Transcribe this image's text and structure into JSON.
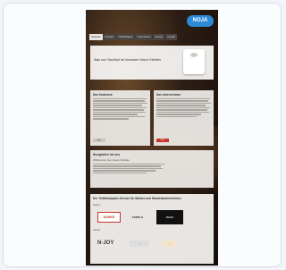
{
  "brand": {
    "logo_text": "NOJA"
  },
  "nav": {
    "items": [
      "Startseite",
      "Produkte",
      "Nachhaltigkeit",
      "Unternehmen",
      "Karriere",
      "Kontakt"
    ]
  },
  "hero": {
    "title": "Was uns 'Nachhal' alt sinnlosen Warm Toiletten"
  },
  "cards": [
    {
      "title": "Das Sortiment",
      "button": "Mehr"
    },
    {
      "title": "Das Unternehmen",
      "button": "Mehr"
    }
  ],
  "news": {
    "title": "Neuigkeiten bei uns",
    "subtitle": "Willkommen bei unserer Website"
  },
  "partners": {
    "title": "Der Toilettenpapier-Service für Marken und Handelsunternehmen",
    "group1": "Marken",
    "group2": "Handel",
    "logos": [
      "DANKE",
      "TEMPLO",
      "ZEWA",
      "N·JOY",
      "—",
      "—"
    ]
  },
  "colors": {
    "accent": "#2e8ad6",
    "cta": "#c8362b"
  },
  "icons": [
    "toilet-paper-roll-icon"
  ]
}
